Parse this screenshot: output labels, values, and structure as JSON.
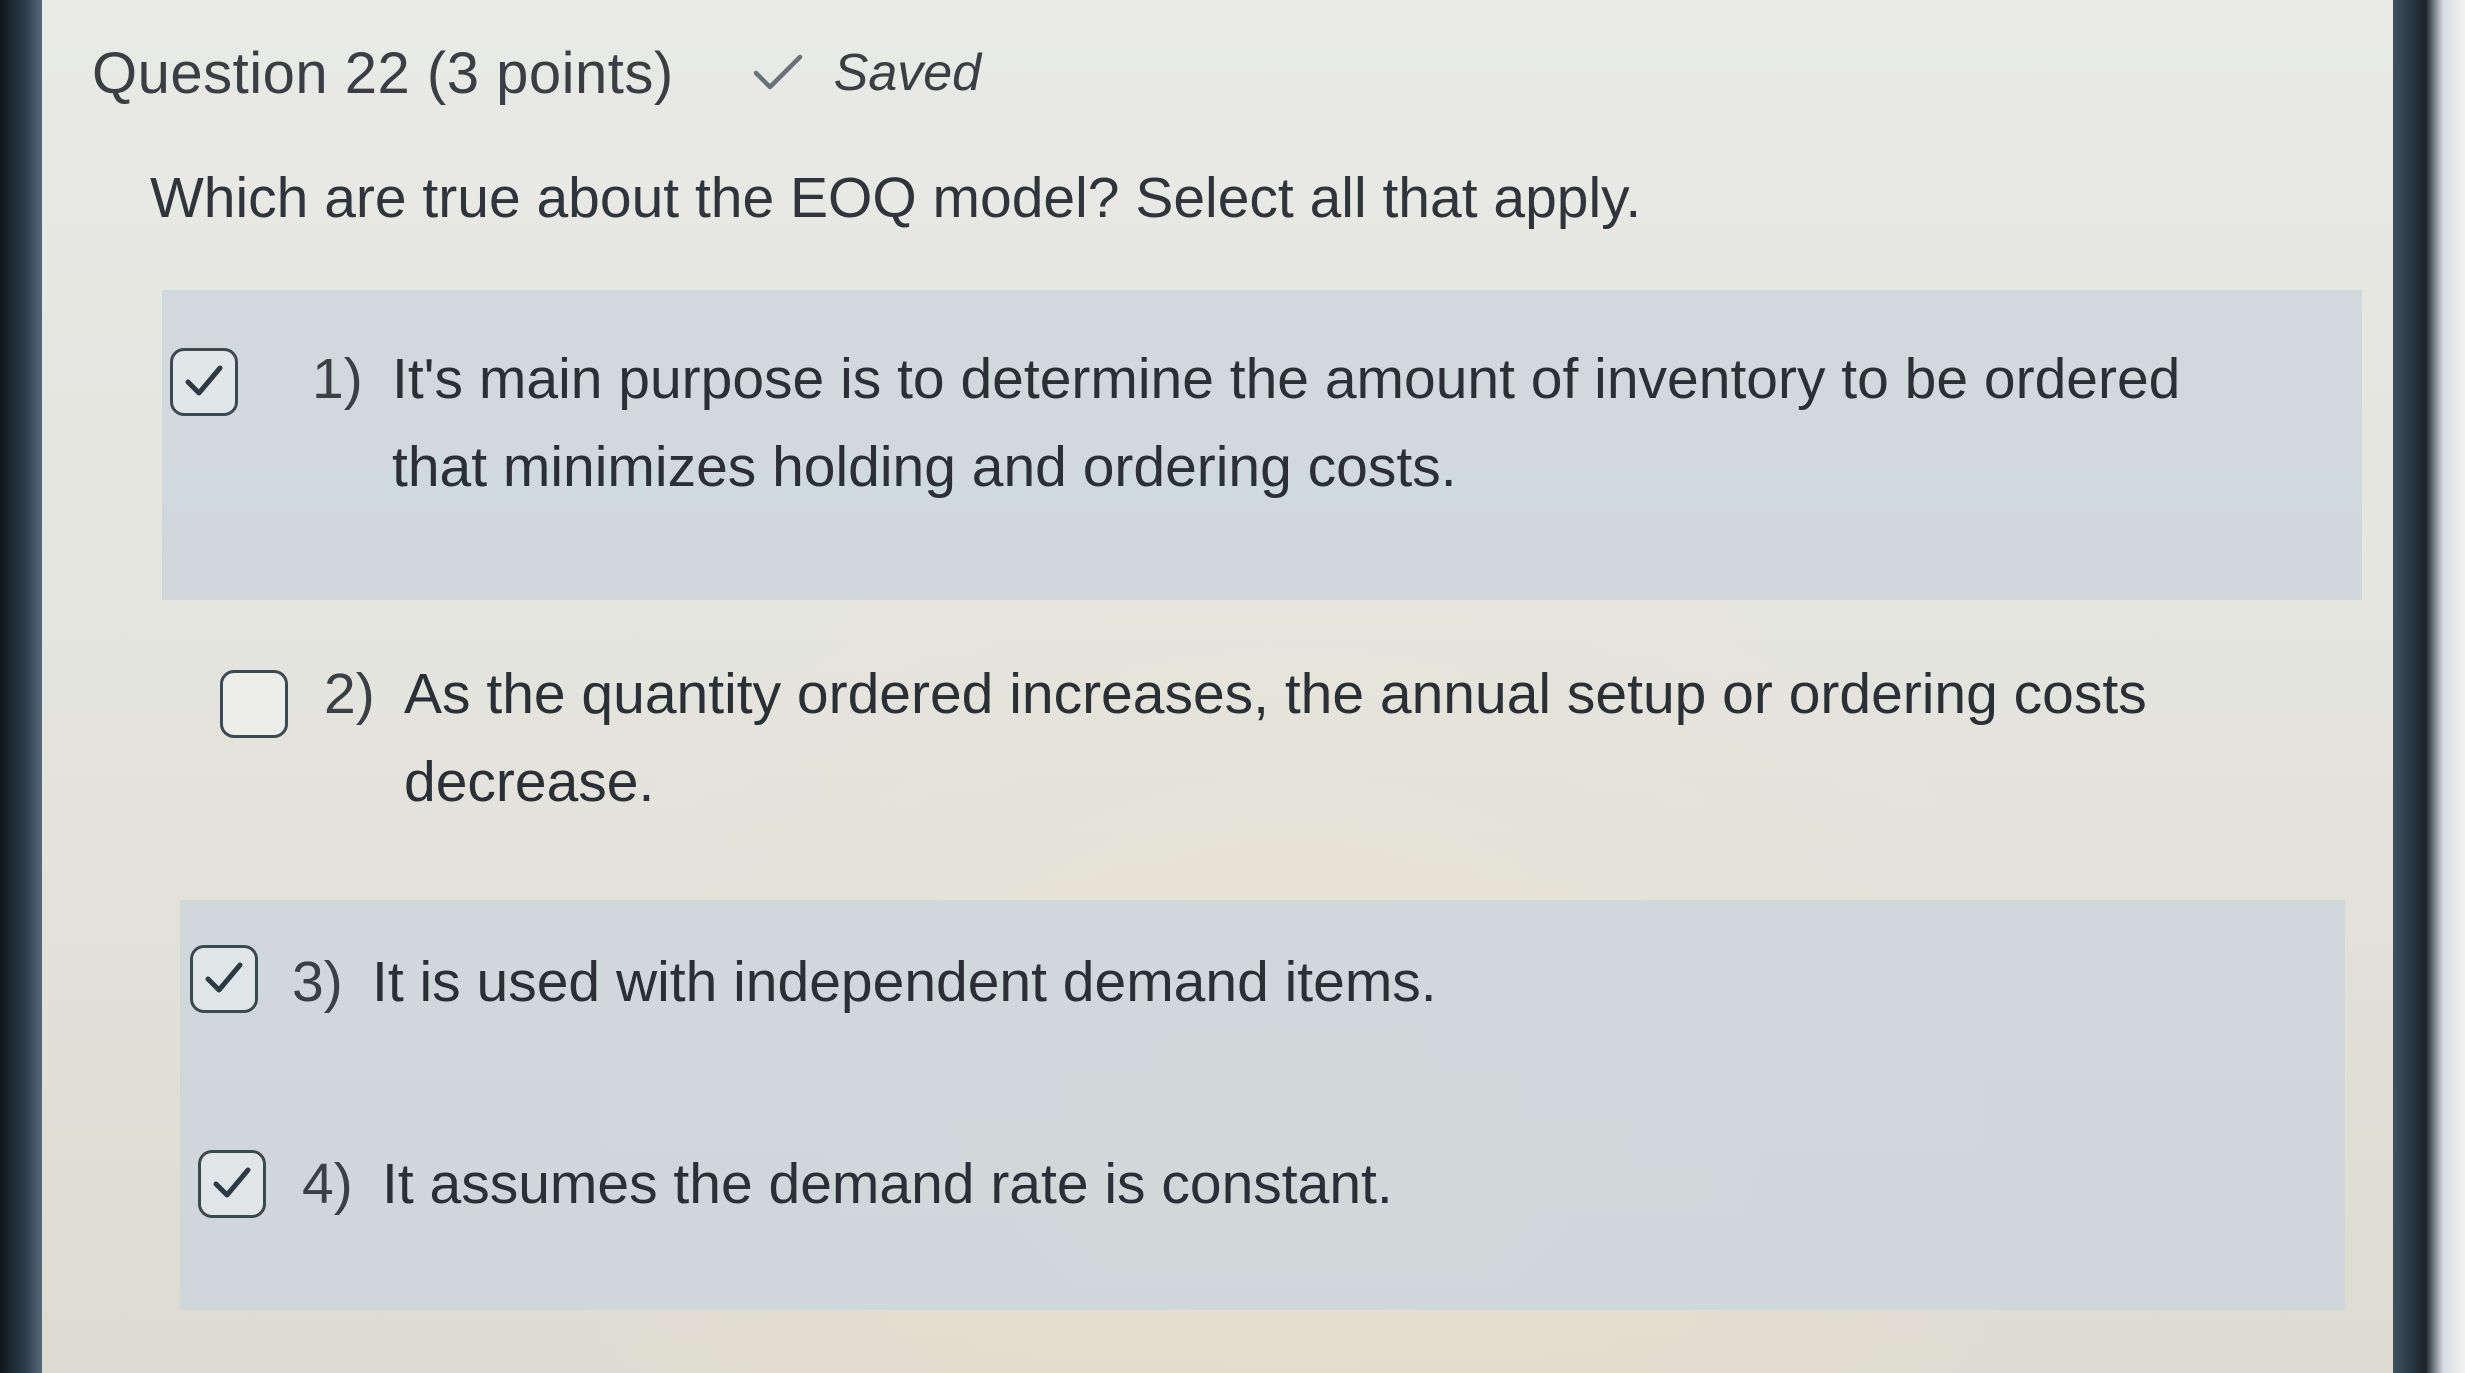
{
  "question": {
    "title": "Question 22 (3 points)",
    "status": "Saved",
    "status_icon": "check-icon",
    "prompt": "Which are true about the EOQ model? Select all that apply."
  },
  "options": [
    {
      "number": "1)",
      "line1": "It's main purpose is to determine the amount of inventory to be ordered",
      "line2": "that minimizes holding and ordering costs.",
      "checked": true
    },
    {
      "number": "2)",
      "line1": "As the quantity ordered increases, the annual setup or ordering costs",
      "line2": "decrease.",
      "checked": false
    },
    {
      "number": "3)",
      "line1": "It is used with independent demand items.",
      "checked": true
    },
    {
      "number": "4)",
      "line1": "It assumes the demand rate is constant.",
      "checked": true
    }
  ],
  "colors": {
    "selected_bg": "#cdd6dc",
    "text": "#2a3035",
    "checkbox_border": "#3d4852"
  }
}
